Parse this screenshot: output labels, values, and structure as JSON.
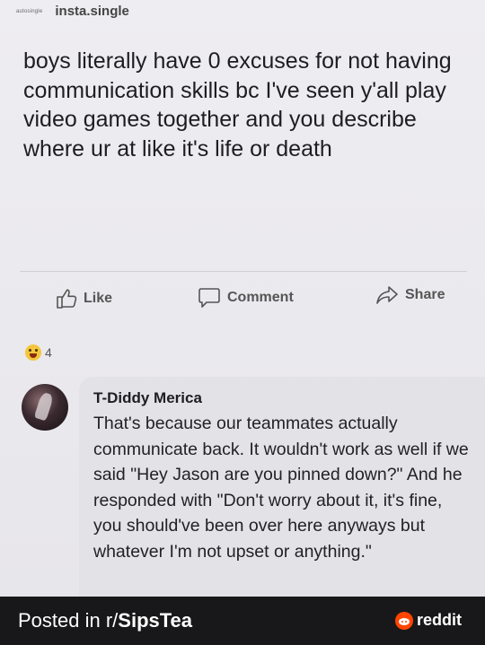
{
  "post": {
    "small_handle": "autosingle",
    "source": "insta.single",
    "text": "boys literally have 0 excuses for not having communication skills bc I've seen y'all play video games together and you describe where ur at like it's life or death",
    "actions": {
      "like_label": "Like",
      "comment_label": "Comment",
      "share_label": "Share"
    },
    "reaction_count": "4",
    "reaction_icon": "laughing-emoji-icon"
  },
  "comment": {
    "author": "T-Diddy Merica",
    "text": "That's because our teammates actually communicate back. It wouldn't work as well if we said \"Hey Jason are you pinned down?\" And he responded with \"Don't worry about it, it's fine, you should've been over here anyways but whatever I'm not upset or anything.\""
  },
  "footer": {
    "posted_prefix": "Posted in r/",
    "subreddit": "SipsTea",
    "brand": "reddit"
  },
  "colors": {
    "reddit_orange": "#ff4500",
    "footer_bg": "#18181a",
    "post_bg": "#eeedf1"
  }
}
